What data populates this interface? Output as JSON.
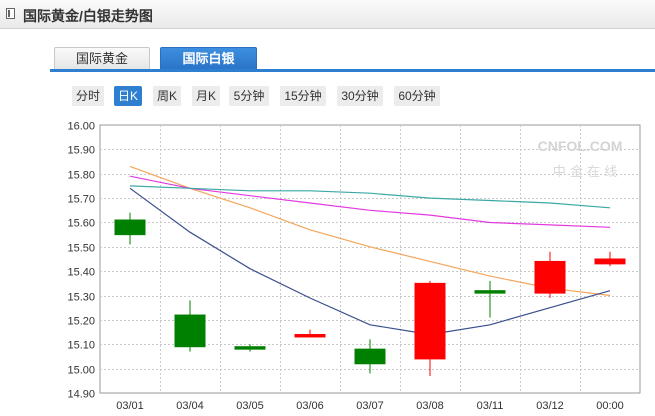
{
  "header": {
    "title": "国际黄金/白银走势图"
  },
  "tabs": [
    {
      "label": "国际黄金",
      "active": false
    },
    {
      "label": "国际白银",
      "active": true
    }
  ],
  "periods": [
    {
      "label": "分时",
      "active": false
    },
    {
      "label": "日K",
      "active": true
    },
    {
      "label": "周K",
      "active": false
    },
    {
      "label": "月K",
      "active": false
    },
    {
      "label": "5分钟",
      "active": false
    },
    {
      "label": "15分钟",
      "active": false
    },
    {
      "label": "30分钟",
      "active": false
    },
    {
      "label": "60分钟",
      "active": false
    }
  ],
  "watermark": {
    "text_en": "CNFOL.COM",
    "text_cn": "中 金 在 线"
  },
  "colors": {
    "accent": "#2f7fd1",
    "up": "#ff0000",
    "down": "#008000",
    "ma_orange": "#f5a55a",
    "ma_navy": "#3a4f8c",
    "ma_magenta": "#e23ae0",
    "ma_teal": "#3aa9a6",
    "grid": "#c9c9c9"
  },
  "chart_data": {
    "type": "candlestick",
    "categories": [
      "03/01",
      "03/04",
      "03/05",
      "03/06",
      "03/07",
      "03/08",
      "03/11",
      "03/12",
      "00:00"
    ],
    "ylim": [
      14.9,
      16.0
    ],
    "yticks": [
      "16.00",
      "15.90",
      "15.80",
      "15.70",
      "15.60",
      "15.50",
      "15.40",
      "15.30",
      "15.20",
      "15.10",
      "15.00",
      "14.90"
    ],
    "grid": true,
    "candles": [
      {
        "open": 15.61,
        "close": 15.55,
        "high": 15.64,
        "low": 15.51
      },
      {
        "open": 15.22,
        "close": 15.09,
        "high": 15.28,
        "low": 15.07
      },
      {
        "open": 15.09,
        "close": 15.08,
        "high": 15.1,
        "low": 15.07
      },
      {
        "open": 15.13,
        "close": 15.14,
        "high": 15.16,
        "low": 15.13
      },
      {
        "open": 15.08,
        "close": 15.02,
        "high": 15.12,
        "low": 14.98
      },
      {
        "open": 15.04,
        "close": 15.35,
        "high": 15.36,
        "low": 14.97
      },
      {
        "open": 15.32,
        "close": 15.31,
        "high": 15.36,
        "low": 15.21
      },
      {
        "open": 15.31,
        "close": 15.44,
        "high": 15.48,
        "low": 15.29
      },
      {
        "open": 15.43,
        "close": 15.45,
        "high": 15.48,
        "low": 15.42
      }
    ],
    "moving_averages": [
      {
        "color": "#f5a55a",
        "values": [
          15.83,
          15.74,
          15.66,
          15.57,
          15.5,
          15.44,
          15.38,
          15.33,
          15.3
        ]
      },
      {
        "color": "#3a4f8c",
        "values": [
          15.74,
          15.56,
          15.41,
          15.29,
          15.18,
          15.14,
          15.18,
          15.25,
          15.32
        ]
      },
      {
        "color": "#e23ae0",
        "values": [
          15.79,
          15.74,
          15.71,
          15.68,
          15.65,
          15.63,
          15.6,
          15.59,
          15.58
        ]
      },
      {
        "color": "#3aa9a6",
        "values": [
          15.75,
          15.74,
          15.73,
          15.73,
          15.72,
          15.7,
          15.69,
          15.68,
          15.66
        ]
      }
    ]
  }
}
